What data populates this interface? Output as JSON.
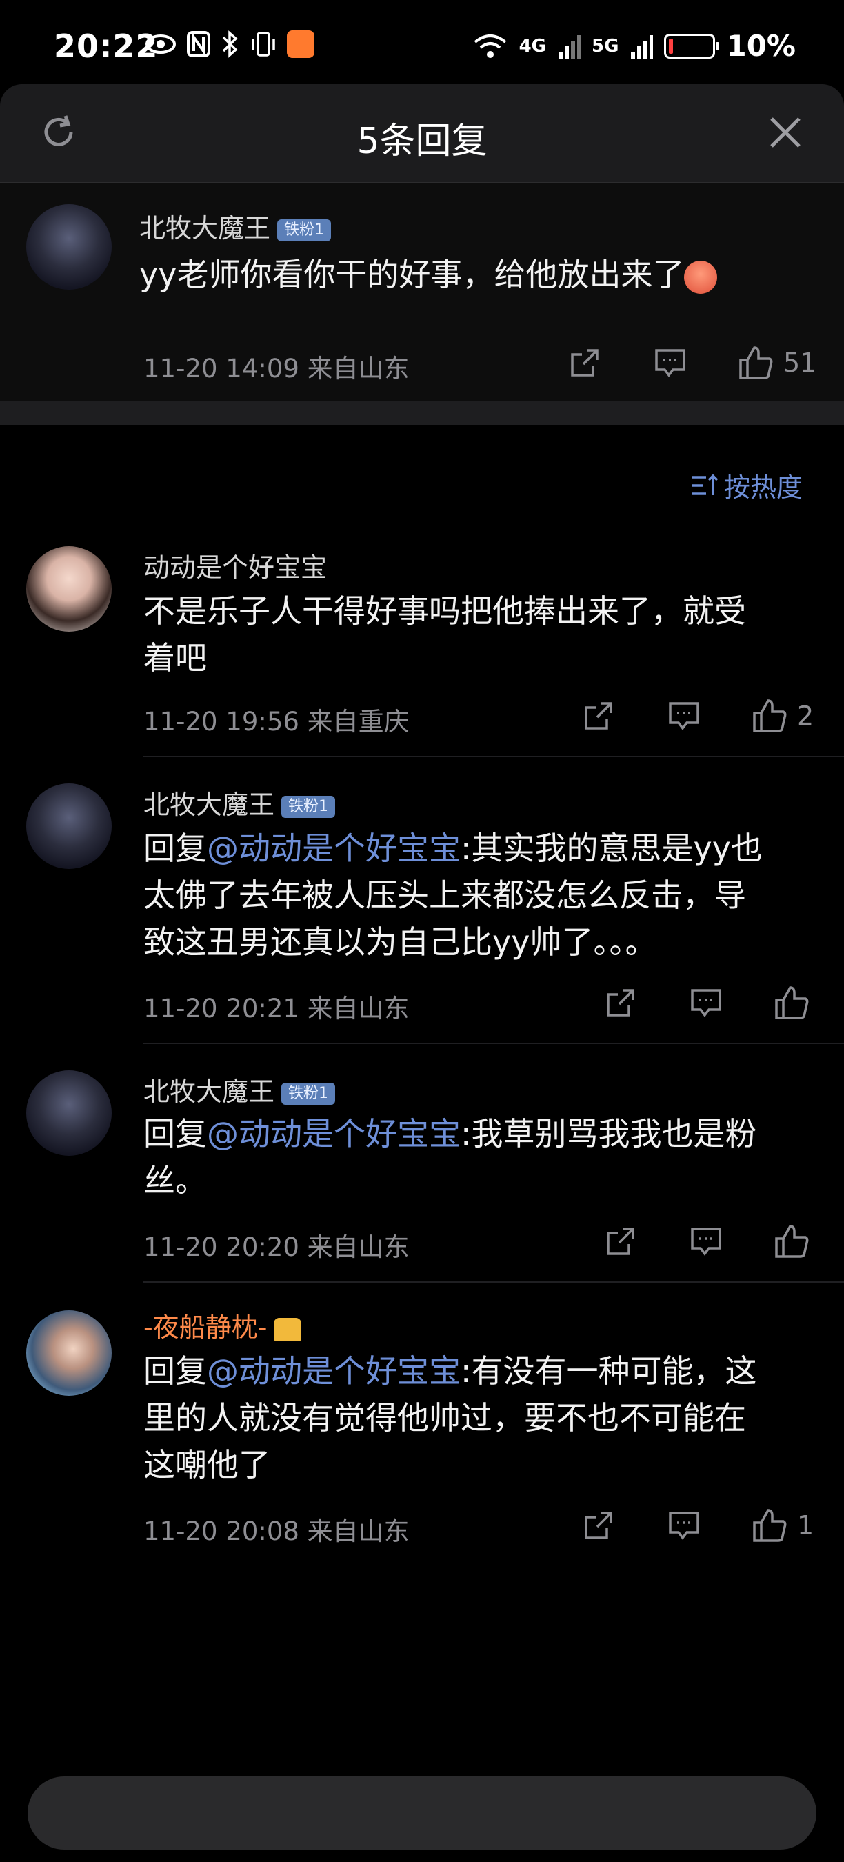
{
  "status_bar": {
    "time": "20:22",
    "signal_1": "4G",
    "signal_2": "5G",
    "battery_percent": "10%",
    "battery_level": 0.1
  },
  "header": {
    "title": "5条回复"
  },
  "original_comment": {
    "username": "北牧大魔王",
    "badge": "铁粉1",
    "text": "yy老师你看你干的好事，给他放出来了",
    "date": "11-20 14:09",
    "location": "来自山东",
    "likes": "51"
  },
  "sort": {
    "label": "按热度"
  },
  "replies": [
    {
      "username": "动动是个好宝宝",
      "text": "不是乐子人干得好事吗把他捧出来了，就受着吧",
      "line1": "不是乐子人干得好事吗把他捧出来了，就受",
      "line2": "着吧",
      "date": "11-20 19:56",
      "location": "来自重庆",
      "likes": "2"
    },
    {
      "username": "北牧大魔王",
      "badge": "铁粉1",
      "reply_prefix": "回复",
      "mention": "@动动是个好宝宝",
      "line1_rest": ":其实我的意思是yy也",
      "line2": "太佛了去年被人压头上来都没怎么反击，导",
      "line3": "致这丑男还真以为自己比yy帅了。。。",
      "date": "11-20 20:21",
      "location": "来自山东",
      "likes": ""
    },
    {
      "username": "北牧大魔王",
      "badge": "铁粉1",
      "reply_prefix": "回复",
      "mention": "@动动是个好宝宝",
      "line1_rest": ":我草别骂我我也是粉",
      "line2": "丝。",
      "date": "11-20 20:20",
      "location": "来自山东",
      "likes": ""
    },
    {
      "username": "-夜船静枕-",
      "reply_prefix": "回复",
      "mention": "@动动是个好宝宝",
      "line1_rest": ":有没有一种可能，这",
      "line2": "里的人就没有觉得他帅过，要不也不可能在",
      "line3": "这嘲他了",
      "date": "11-20 20:08",
      "location": "来自山东",
      "likes": "1"
    }
  ],
  "input": {
    "placeholder": ""
  },
  "colors": {
    "mention": "#6e8fd8",
    "vip_name": "#ff8a4a",
    "background": "#000000"
  }
}
